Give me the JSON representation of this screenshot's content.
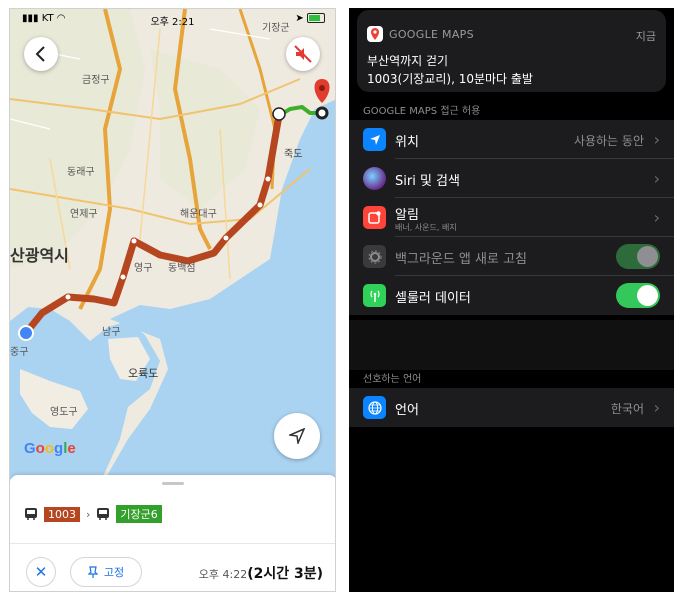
{
  "left": {
    "status": {
      "carrier": "KT",
      "time": "오후 2:21"
    },
    "map_labels": [
      {
        "id": "gijang-top",
        "text": "기장군"
      },
      {
        "id": "geumjeong",
        "text": "금정구"
      },
      {
        "id": "dongrae",
        "text": "동래구"
      },
      {
        "id": "yeonje",
        "text": "연제구"
      },
      {
        "id": "busan",
        "text": "산광역시"
      },
      {
        "id": "haeundae",
        "text": "해운대구"
      },
      {
        "id": "jukdo",
        "text": "죽도"
      },
      {
        "id": "yeonggu",
        "text": "영구"
      },
      {
        "id": "dongbaek",
        "text": "동백섬"
      },
      {
        "id": "namgu",
        "text": "남구"
      },
      {
        "id": "oryukdo",
        "text": "오륙도"
      },
      {
        "id": "yeongdogu",
        "text": "영도구"
      },
      {
        "id": "junggu",
        "text": "중구"
      }
    ],
    "google": [
      "G",
      "o",
      "o",
      "g",
      "l",
      "e"
    ],
    "route": {
      "bus1": "1003",
      "bus2": "기장군6",
      "arrow": "›"
    },
    "bottom": {
      "close": "✕",
      "pin_label": "고정",
      "eta_time": "오후 4:22",
      "eta_duration": "(2시간 3분)"
    },
    "colors": {
      "route": "#b5461f",
      "walk": "#3fae2a",
      "badge1": "#b5461f",
      "badge2": "#32a02a",
      "accent": "#1a73e8"
    }
  },
  "right": {
    "notification": {
      "app": "GOOGLE MAPS",
      "time": "지금",
      "line1": "부산역까지 걷기",
      "line2": "1003(기장교리), 10분마다 출발"
    },
    "access_header": "GOOGLE MAPS 접근 허용",
    "rows": [
      {
        "label": "위치",
        "value": "사용하는 동안",
        "icon": "location-arrow-icon"
      },
      {
        "label": "Siri 및 검색",
        "icon": "siri-icon"
      },
      {
        "label": "알림",
        "sub": "배너, 사운드, 배지",
        "icon": "notification-icon"
      },
      {
        "label": "백그라운드 앱 새로 고침",
        "icon": "gear-icon",
        "toggle": true,
        "disabled": true
      },
      {
        "label": "셀룰러 데이터",
        "icon": "cellular-icon",
        "toggle": true
      }
    ],
    "language_header": "선호하는 언어",
    "language_row": {
      "label": "언어",
      "value": "한국어",
      "icon": "globe-icon"
    },
    "colors": {
      "toggle_on": "#34c759",
      "toggle_dim": "#2e6b3a",
      "blue": "#0a84ff",
      "red": "#ff453a",
      "green": "#30d158"
    }
  }
}
